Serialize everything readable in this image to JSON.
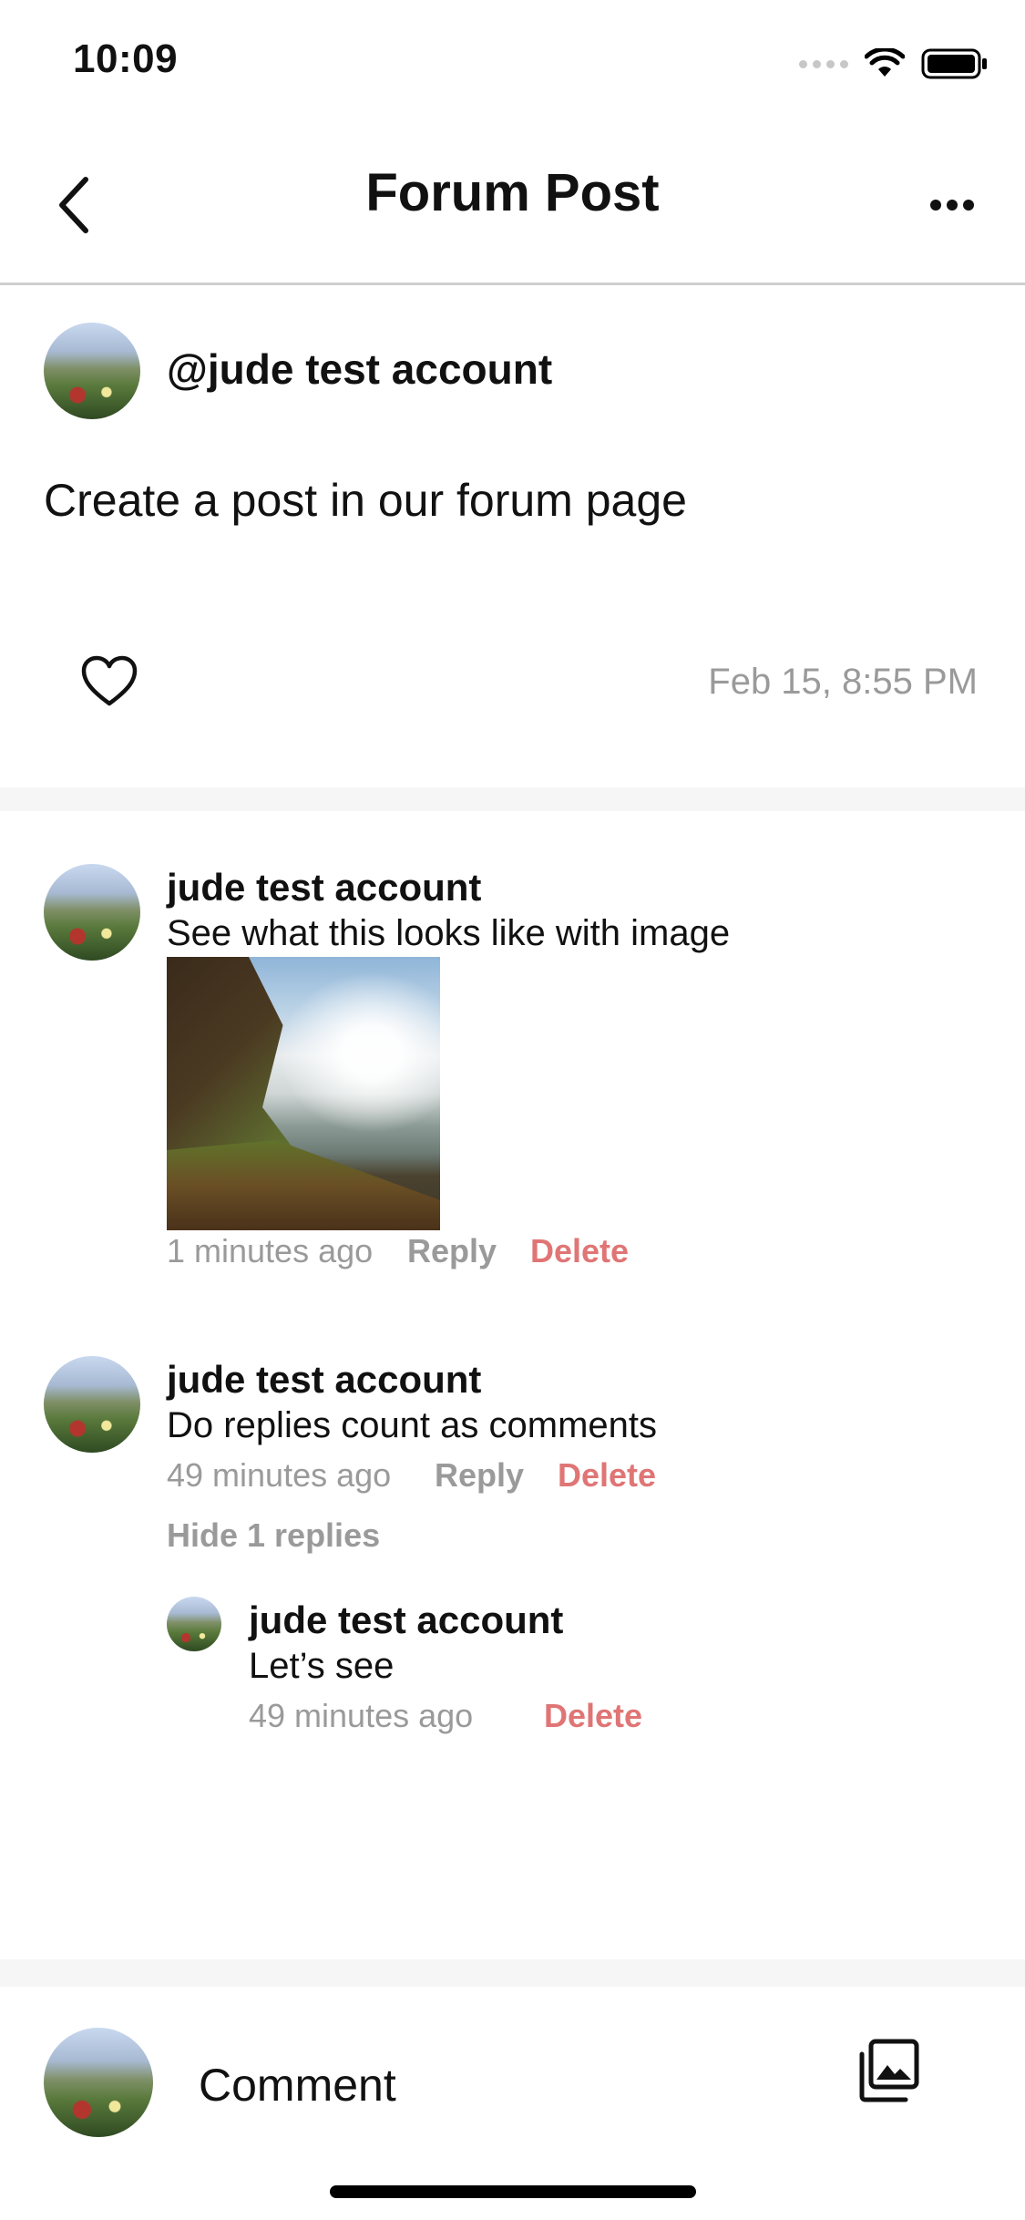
{
  "status_bar": {
    "time": "10:09"
  },
  "nav": {
    "title": "Forum Post",
    "back_icon": "chevron-left-icon",
    "more_icon": "ellipsis-icon"
  },
  "post": {
    "author": "@jude test account",
    "body": "Create a post in our forum page",
    "date": "Feb 15, 8:55 PM",
    "like_icon": "heart-outline-icon"
  },
  "comments": [
    {
      "name": "jude test account",
      "text": "See what this looks like with image",
      "time": "1 minutes ago",
      "reply": "Reply",
      "delete": "Delete",
      "has_image": true
    },
    {
      "name": "jude test account",
      "text": "Do replies count as comments",
      "time": "49 minutes ago",
      "reply": "Reply",
      "delete": "Delete",
      "toggle_replies": "Hide 1 replies",
      "replies": [
        {
          "name": "jude test account",
          "text": "Let’s see",
          "time": "49 minutes ago",
          "delete": "Delete"
        }
      ]
    }
  ],
  "composer": {
    "placeholder": "Comment",
    "gallery_icon": "photo-gallery-icon"
  },
  "colors": {
    "delete": "#e07575",
    "muted": "#9a9a9a",
    "divider": "#cfcfcf"
  }
}
